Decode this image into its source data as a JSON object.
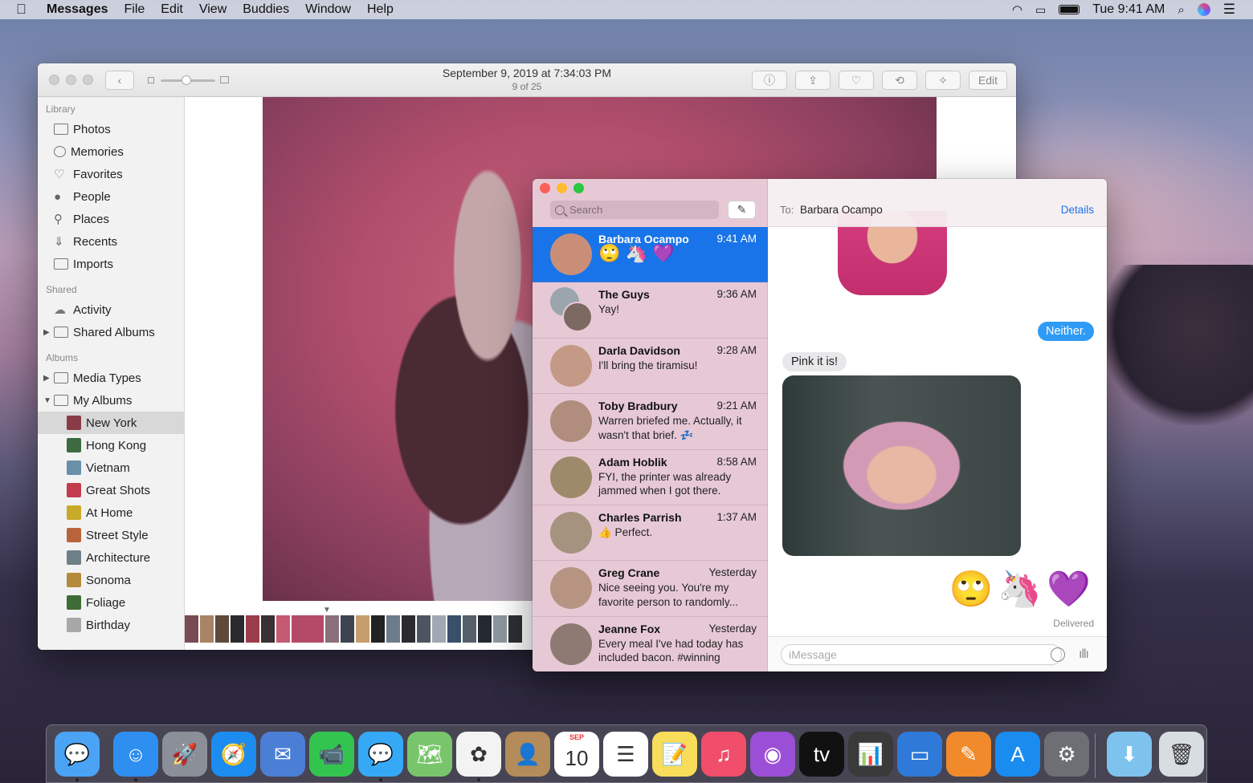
{
  "menubar": {
    "apple": "",
    "app": "Messages",
    "items": [
      "File",
      "Edit",
      "View",
      "Buddies",
      "Window",
      "Help"
    ],
    "clock": "Tue 9:41 AM"
  },
  "photos": {
    "title": "September 9, 2019 at 7:34:03 PM",
    "subtitle": "9 of 25",
    "edit_label": "Edit",
    "sidebar": {
      "library_header": "Library",
      "library": [
        "Photos",
        "Memories",
        "Favorites",
        "People",
        "Places",
        "Recents",
        "Imports"
      ],
      "shared_header": "Shared",
      "shared": [
        "Activity",
        "Shared Albums"
      ],
      "albums_header": "Albums",
      "albums": [
        "Media Types",
        "My Albums"
      ],
      "my_albums": [
        "New York",
        "Hong Kong",
        "Vietnam",
        "Great Shots",
        "At Home",
        "Street Style",
        "Architecture",
        "Sonoma",
        "Foliage",
        "Birthday"
      ],
      "selected_album": "New York"
    }
  },
  "messages": {
    "search_placeholder": "Search",
    "to_label": "To:",
    "to_name": "Barbara Ocampo",
    "details_label": "Details",
    "conversations": [
      {
        "name": "Barbara Ocampo",
        "time": "9:41 AM",
        "preview": "🙄 🦄 💜",
        "selected": true,
        "avatar": "#c98e78"
      },
      {
        "name": "The Guys",
        "time": "9:36 AM",
        "preview": "Yay!",
        "selected": false,
        "avatar": "#8a9aa4"
      },
      {
        "name": "Darla Davidson",
        "time": "9:28 AM",
        "preview": "I'll bring the tiramisu!",
        "selected": false,
        "avatar": "#c49a86"
      },
      {
        "name": "Toby Bradbury",
        "time": "9:21 AM",
        "preview": "Warren briefed me. Actually, it wasn't that brief. 💤",
        "selected": false,
        "avatar": "#b08d7c"
      },
      {
        "name": "Adam Hoblik",
        "time": "8:58 AM",
        "preview": "FYI, the printer was already jammed when I got there.",
        "selected": false,
        "avatar": "#9d8a6a"
      },
      {
        "name": "Charles Parrish",
        "time": "1:37 AM",
        "preview": "👍 Perfect.",
        "selected": false,
        "avatar": "#a5927f"
      },
      {
        "name": "Greg Crane",
        "time": "Yesterday",
        "preview": "Nice seeing you. You're my favorite person to randomly...",
        "selected": false,
        "avatar": "#b79482"
      },
      {
        "name": "Jeanne Fox",
        "time": "Yesterday",
        "preview": "Every meal I've had today has included bacon. #winning",
        "selected": false,
        "avatar": "#8d7a72"
      }
    ],
    "thread": {
      "outgoing_text": "Neither.",
      "incoming_text": "Pink it is!",
      "emojis": "🙄🦄💜",
      "status": "Delivered"
    },
    "input_placeholder": "iMessage"
  },
  "dock": {
    "apps": [
      {
        "name": "messages-tinyapp-icon",
        "glyph": "💬",
        "color": "#4aa3f5"
      },
      {
        "name": "finder-icon",
        "glyph": "☺",
        "color": "#2f8ff0"
      },
      {
        "name": "launchpad-icon",
        "glyph": "🚀",
        "color": "#8a8f98"
      },
      {
        "name": "safari-icon",
        "glyph": "🧭",
        "color": "#1d8cf0"
      },
      {
        "name": "mail-icon",
        "glyph": "✉",
        "color": "#4b7fd6"
      },
      {
        "name": "facetime-icon",
        "glyph": "📹",
        "color": "#32c44e"
      },
      {
        "name": "messages-icon",
        "glyph": "💬",
        "color": "#35a9f6"
      },
      {
        "name": "maps-icon",
        "glyph": "🗺",
        "color": "#79c56b"
      },
      {
        "name": "photos-icon",
        "glyph": "✿",
        "color": "#f3f3f3"
      },
      {
        "name": "contacts-icon",
        "glyph": "👤",
        "color": "#b48b5a"
      },
      {
        "name": "calendar-icon",
        "glyph": "10",
        "color": "#ffffff"
      },
      {
        "name": "reminders-icon",
        "glyph": "☰",
        "color": "#ffffff"
      },
      {
        "name": "notes-icon",
        "glyph": "📝",
        "color": "#f7dd5a"
      },
      {
        "name": "music-icon",
        "glyph": "♫",
        "color": "#f04e6a"
      },
      {
        "name": "podcasts-icon",
        "glyph": "◉",
        "color": "#9b4fd6"
      },
      {
        "name": "tv-icon",
        "glyph": "tv",
        "color": "#111111"
      },
      {
        "name": "numbers-icon",
        "glyph": "📊",
        "color": "#3a3a3a"
      },
      {
        "name": "keynote-icon",
        "glyph": "▭",
        "color": "#2f7ad9"
      },
      {
        "name": "pages-icon",
        "glyph": "✎",
        "color": "#f08a2a"
      },
      {
        "name": "app-store-icon",
        "glyph": "A",
        "color": "#1a8cf0"
      },
      {
        "name": "system-preferences-icon",
        "glyph": "⚙",
        "color": "#6d6f74"
      },
      {
        "name": "downloads-folder-icon",
        "glyph": "⬇",
        "color": "#7ec3ee"
      },
      {
        "name": "trash-icon",
        "glyph": "🗑",
        "color": "#d8dde2"
      }
    ],
    "calendar_month": "SEP"
  }
}
